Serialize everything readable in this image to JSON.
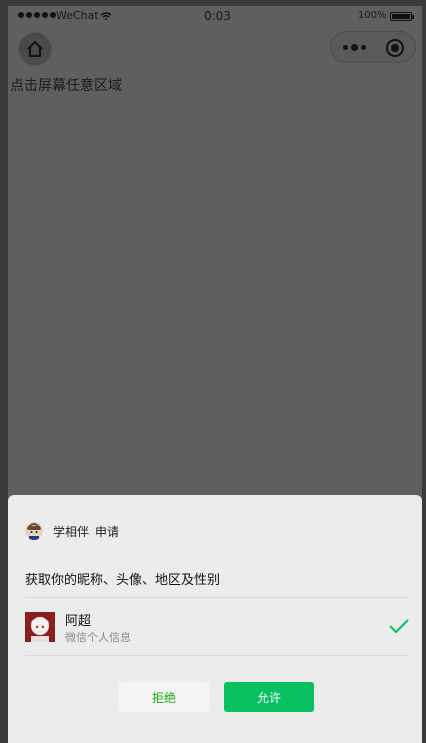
{
  "status_bar": {
    "carrier": "WeChat",
    "time": "0:03",
    "battery": "100%",
    "battery_level": 1.0
  },
  "page": {
    "tap_hint": "点击屏幕任意区域"
  },
  "auth_sheet": {
    "app_name": "学相伴",
    "request_label": "申请",
    "permission_text": "获取你的昵称、头像、地区及性别",
    "user_name": "阿超",
    "user_subtitle": "微信个人信息",
    "reject_label": "拒绝",
    "allow_label": "允许"
  },
  "colors": {
    "accent_green": "#07c160",
    "reject_text": "#1aad19",
    "overlay": "#5f5f5f"
  },
  "icons": {
    "home": "home-icon",
    "more": "more-dots-icon",
    "close": "target-circle-icon",
    "check": "check-icon"
  }
}
